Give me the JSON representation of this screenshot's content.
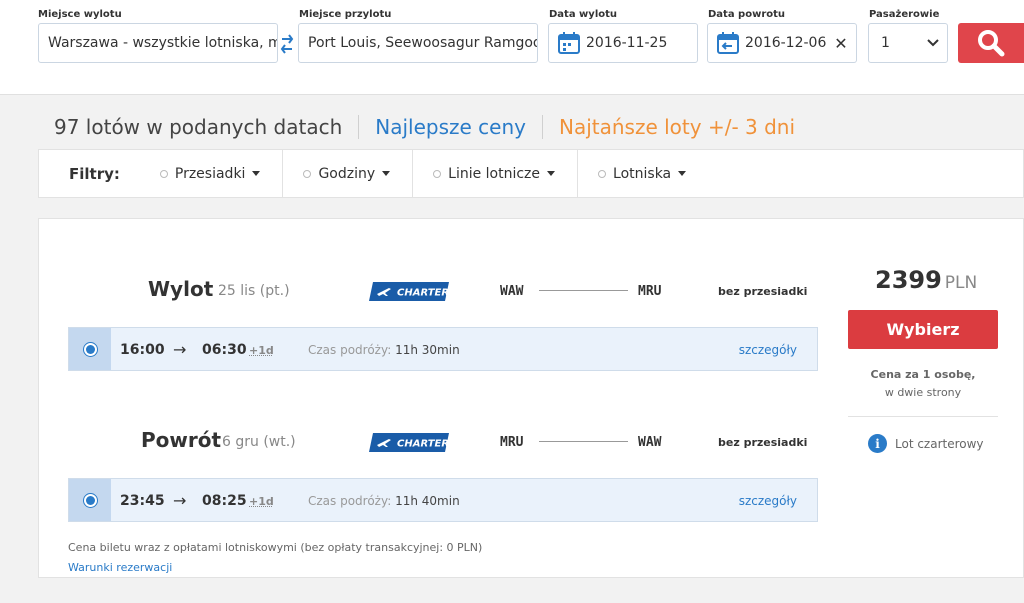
{
  "search": {
    "from_label": "Miejsce wylotu",
    "from_value": "Warszawa - wszystkie lotniska, ma",
    "to_label": "Miejsce przylotu",
    "to_value": "Port Louis, Seewoosagur Ramgoo",
    "depart_label": "Data wylotu",
    "depart_value": "2016-11-25",
    "return_label": "Data powrotu",
    "return_value": "2016-12-06",
    "clear_glyph": "✕",
    "pax_label": "Pasażerowie",
    "pax_value": "1"
  },
  "results": {
    "count_text": "97 lotów w podanych datach",
    "best_link": "Najlepsze ceny",
    "cheapest_link": "Najtańsze loty +/- 3 dni"
  },
  "filters": {
    "label": "Filtry:",
    "items": [
      "Przesiadki",
      "Godziny",
      "Linie lotnicze",
      "Lotniska"
    ]
  },
  "offer": {
    "outbound": {
      "title": "Wylot",
      "date": "25 lis (pt.)",
      "airline_badge": "CHARTER",
      "from": "WAW",
      "to": "MRU",
      "stops": "bez przesiadki",
      "depart_time": "16:00",
      "arrow": "→",
      "arrive_time": "06:30",
      "day_offset": "+1d",
      "duration_label": "Czas podróży:",
      "duration_value": "11h 30min",
      "details_link": "szczegóły"
    },
    "inbound": {
      "title": "Powrót",
      "date": "6 gru (wt.)",
      "airline_badge": "CHARTER",
      "from": "MRU",
      "to": "WAW",
      "stops": "bez przesiadki",
      "depart_time": "23:45",
      "arrow": "→",
      "arrive_time": "08:25",
      "day_offset": "+1d",
      "duration_label": "Czas podróży:",
      "duration_value": "11h 40min",
      "details_link": "szczegóły"
    },
    "price_amount": "2399",
    "price_currency": "PLN",
    "choose_button": "Wybierz",
    "per_person": "Cena za 1 osobę,",
    "both_ways": "w dwie strony",
    "info_glyph": "i",
    "charter_info": "Lot czarterowy",
    "price_note": "Cena biletu wraz z opłatami lotniskowymi (bez opłaty transakcyjnej: 0 PLN)",
    "terms_link": "Warunki rezerwacji"
  },
  "colors": {
    "accent_blue": "#2a7bc8",
    "accent_orange": "#f0923a",
    "cta_red": "#db3c40",
    "search_red": "#e0454b",
    "charter_blue": "#1a5ca8"
  }
}
